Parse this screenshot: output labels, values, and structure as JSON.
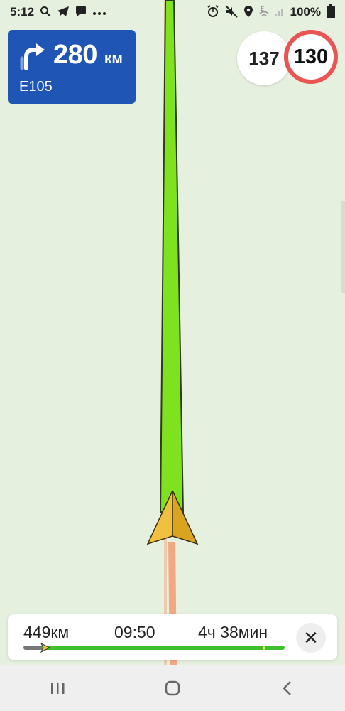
{
  "status_bar": {
    "time": "5:12",
    "battery_percent": "100%",
    "left_icons": [
      "search-icon",
      "telegram-icon",
      "chat-icon",
      "more-icon"
    ],
    "right_icons": [
      "alarm-icon",
      "mute-icon",
      "location-icon",
      "wifi-icon",
      "signal-icon",
      "battery-icon"
    ]
  },
  "maneuver": {
    "direction": "turn-right",
    "distance": "280",
    "unit": "км",
    "road": "E105",
    "color": "#1f56b5"
  },
  "speed": {
    "current": "137",
    "limit": "130",
    "limit_color": "#ea5452"
  },
  "route_panel": {
    "distance_left": "449км",
    "arrival_time": "09:50",
    "time_left": "4ч 38мин",
    "progress_fraction": 0.08,
    "close_label": "✕"
  },
  "route_colors": {
    "route": "#7fe21e",
    "traveled": "#f3a882",
    "arrow": "#f0c040"
  },
  "nav_bar": {
    "buttons": [
      "recent-apps-icon",
      "home-icon",
      "back-icon"
    ]
  }
}
